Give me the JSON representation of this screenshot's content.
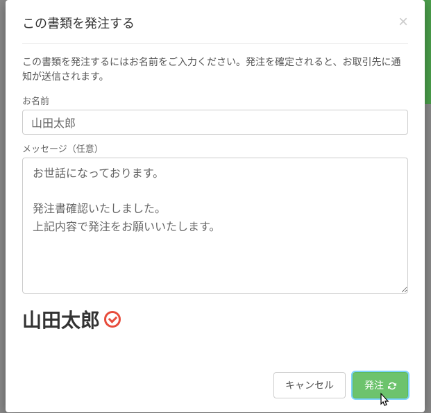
{
  "modal": {
    "title": "この書類を発注する",
    "description": "この書類を発注するにはお名前をご入力ください。発注を確定されると、お取引先に通知が送信されます。",
    "name_label": "お名前",
    "name_value": "山田太郎",
    "message_label": "メッセージ（任意）",
    "message_value": "お世話になっております。\n\n発注書確認いたしました。\n上記内容で発注をお願いいたします。",
    "signature_name": "山田太郎",
    "cancel_label": "キャンセル",
    "submit_label": "発注"
  }
}
